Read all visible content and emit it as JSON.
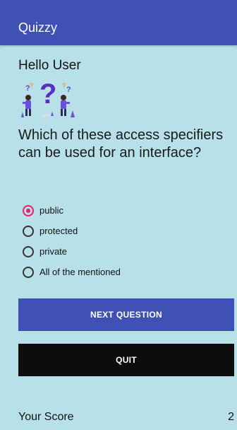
{
  "app_bar": {
    "title": "Quizzy",
    "color": "#3f51b5"
  },
  "greeting": "Hello User",
  "illustration": {
    "icon": "confused-people-question-marks-illustration"
  },
  "question": "Which of these access specifiers can be used for an interface?",
  "options": [
    {
      "label": "public",
      "selected": true
    },
    {
      "label": "protected",
      "selected": false
    },
    {
      "label": "private",
      "selected": false
    },
    {
      "label": "All of the mentioned",
      "selected": false
    }
  ],
  "buttons": {
    "next_label": "NEXT QUESTION",
    "quit_label": "QUIT"
  },
  "score": {
    "label": "Your Score",
    "value": "2"
  },
  "colors": {
    "background": "#b8e0e9",
    "primary": "#3f51b5",
    "accent": "#e91e63",
    "quit_button": "#0d0d0d"
  }
}
